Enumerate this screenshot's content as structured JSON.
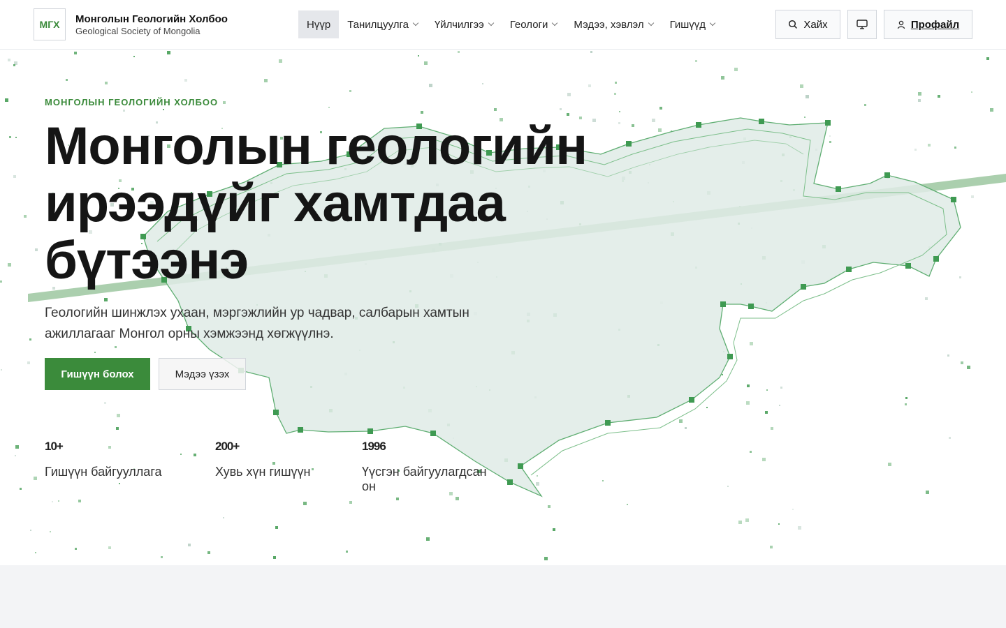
{
  "header": {
    "logo_text": "МГХ",
    "brand_title": "Монголын Геологийн Холбоо",
    "brand_subtitle": "Geological Society of Mongolia",
    "nav": [
      {
        "label": "Нүүр",
        "active": true,
        "dropdown": false
      },
      {
        "label": "Танилцуулга",
        "active": false,
        "dropdown": true
      },
      {
        "label": "Үйлчилгээ",
        "active": false,
        "dropdown": true
      },
      {
        "label": "Геологи",
        "active": false,
        "dropdown": true
      },
      {
        "label": "Мэдээ, хэвлэл",
        "active": false,
        "dropdown": true
      },
      {
        "label": "Гишүүд",
        "active": false,
        "dropdown": true
      }
    ],
    "search_label": "Хайх",
    "display_icon": "monitor-icon",
    "profile_label": "Профайл"
  },
  "hero": {
    "kicker": "МОНГОЛЫН ГЕОЛОГИЙН ХОЛБОО",
    "headline": "Монголын геологийн ирээдүйг хамтдаа бүтээнэ",
    "lead": "Геологийн шинжлэх ухаан, мэргэжлийн ур чадвар, салбарын хамтын ажиллагааг Монгол орны хэмжээнд хөгжүүлнэ.",
    "primary_button": "Гишүүн болох",
    "secondary_button": "Мэдээ үзэх",
    "stats": [
      {
        "value": "10+",
        "label": "Гишүүн байгууллага"
      },
      {
        "value": "200+",
        "label": "Хувь хүн гишүүн"
      },
      {
        "value": "1996",
        "label": "Үүсгэн байгуулагдсан он"
      }
    ]
  },
  "colors": {
    "accent": "#3b8b3b",
    "map_fill": "#e3eeea",
    "map_stroke": "#5fae72"
  }
}
